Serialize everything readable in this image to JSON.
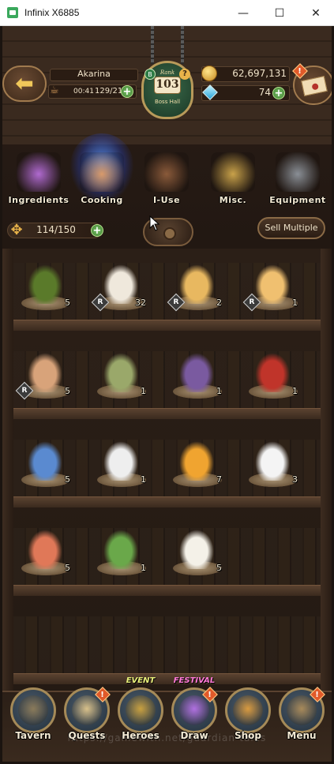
{
  "window": {
    "title": "Infinix X6885",
    "minimize": "—",
    "maximize": "☐",
    "close": "✕"
  },
  "hud": {
    "player_name": "Akarina",
    "stamina_timer": "00:41",
    "stamina": "129/211",
    "rank_label": "Rank",
    "rank_value": "103",
    "rank_sub": "Boss Hall",
    "rank_badge_letter": "B",
    "rank_help": "?",
    "gold": "62,697,131",
    "gems": "74",
    "mail_alert": "!"
  },
  "tabs": [
    {
      "label": "Ingredients",
      "icon": "ingredients-icon",
      "color": "#b06ad0",
      "active": false
    },
    {
      "label": "Cooking",
      "icon": "cooking-icon",
      "color": "#d99a6a",
      "active": true
    },
    {
      "label": "I-Use",
      "icon": "i-use-icon",
      "color": "#8a5a3a",
      "active": false
    },
    {
      "label": "Misc.",
      "icon": "misc-icon",
      "color": "#c9a24a",
      "active": false
    },
    {
      "label": "Equipment",
      "icon": "equipment-icon",
      "color": "#8a8f96",
      "active": false
    }
  ],
  "inventory": {
    "count": "114/150",
    "sell_label": "Sell Multiple"
  },
  "items": [
    {
      "icon": "green-bottle-icon",
      "count": "5",
      "rarity": "",
      "color": "#5a7a2a"
    },
    {
      "icon": "berry-drink-icon",
      "count": "32",
      "rarity": "R",
      "color": "#efe8dc"
    },
    {
      "icon": "pudding-plate-icon",
      "count": "2",
      "rarity": "R",
      "color": "#e8b860"
    },
    {
      "icon": "caramel-pudding-icon",
      "count": "1",
      "rarity": "R",
      "color": "#f0c070"
    },
    {
      "icon": "seafood-platter-icon",
      "count": "5",
      "rarity": "R",
      "color": "#d8a37a"
    },
    {
      "icon": "pickle-jar-icon",
      "count": "1",
      "rarity": "",
      "color": "#9aa86a"
    },
    {
      "icon": "grape-cheese-icon",
      "count": "1",
      "rarity": "",
      "color": "#7a5aa0"
    },
    {
      "icon": "tomato-basket-icon",
      "count": "1",
      "rarity": "",
      "color": "#c0342a"
    },
    {
      "icon": "blue-eggs-icon",
      "count": "5",
      "rarity": "",
      "color": "#5a8ad0"
    },
    {
      "icon": "white-eggs-icon",
      "count": "1",
      "rarity": "",
      "color": "#eeeeee"
    },
    {
      "icon": "honeycomb-plate-icon",
      "count": "7",
      "rarity": "",
      "color": "#f0a430"
    },
    {
      "icon": "sugar-cubes-icon",
      "count": "3",
      "rarity": "",
      "color": "#f4f4f4"
    },
    {
      "icon": "meat-salmon-icon",
      "count": "5",
      "rarity": "",
      "color": "#e07858"
    },
    {
      "icon": "salad-icon",
      "count": "1",
      "rarity": "",
      "color": "#6aa84a"
    },
    {
      "icon": "milk-jug-icon",
      "count": "5",
      "rarity": "",
      "color": "#f4f1e8"
    }
  ],
  "nav": [
    {
      "label": "Tavern",
      "icon": "tavern-icon",
      "tag": "",
      "alert": "",
      "color": "#8a7a5a"
    },
    {
      "label": "Quests",
      "icon": "quests-icon",
      "tag": "",
      "alert": "!",
      "color": "#d8c08a"
    },
    {
      "label": "Heroes",
      "icon": "heroes-icon",
      "tag": "EVENT",
      "alert": "",
      "color": "#c8a040"
    },
    {
      "label": "Draw",
      "icon": "draw-icon",
      "tag": "FESTIVAL",
      "alert": "!",
      "color": "#b070e0"
    },
    {
      "label": "Shop",
      "icon": "shop-icon",
      "tag": "",
      "alert": "",
      "color": "#d89a40"
    },
    {
      "label": "Menu",
      "icon": "menu-gear-icon",
      "tag": "",
      "alert": "!",
      "color": "#a88a5a"
    }
  ],
  "watermark": "https://gamewith.net/guardian-tales"
}
